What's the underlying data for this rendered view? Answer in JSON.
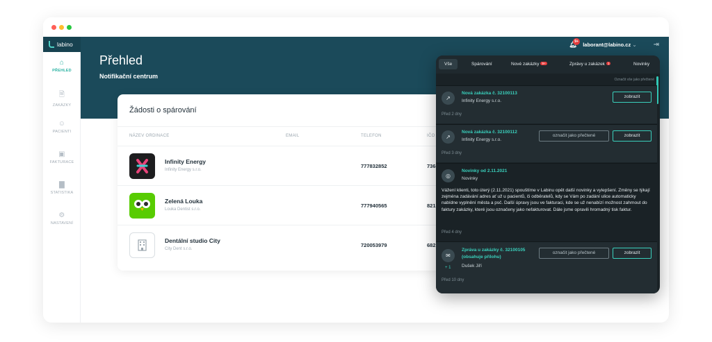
{
  "app": {
    "logo": "labino"
  },
  "topbar": {
    "user": "laborant@labino.cz",
    "notif_count": "9+"
  },
  "hero": {
    "title": "Přehled",
    "subtitle": "Notifikační centrum"
  },
  "sidebar": {
    "items": [
      {
        "label": "PŘEHLED",
        "icon": "home-icon",
        "active": true
      },
      {
        "label": "ZAKÁZKY",
        "icon": "document-icon",
        "active": false
      },
      {
        "label": "PACIENTI",
        "icon": "user-icon",
        "active": false
      },
      {
        "label": "FAKTURACE",
        "icon": "money-icon",
        "active": false
      },
      {
        "label": "STATISTIKA",
        "icon": "chart-icon",
        "active": false
      },
      {
        "label": "NASTAVENÍ",
        "icon": "gear-icon",
        "active": false
      }
    ]
  },
  "card": {
    "title": "Žádosti o spárování",
    "columns": [
      "NÁZEV ORDINACE",
      "EMAIL",
      "TELEFON",
      "IČO"
    ],
    "rows": [
      {
        "name": "Infinity Energy",
        "company": "Infinity Energy s.r.o.",
        "phone": "777832852",
        "ico": "736"
      },
      {
        "name": "Zelená Louka",
        "company": "Louka Dentist s.r.o.",
        "phone": "777940565",
        "ico": "821"
      },
      {
        "name": "Dentální studio City",
        "company": "City Dent s.r.o.",
        "phone": "720053979",
        "ico": "682"
      }
    ]
  },
  "panel": {
    "tabs": [
      {
        "label": "Vše"
      },
      {
        "label": "Spárování"
      },
      {
        "label": "Nové zakázky",
        "badge": "9+"
      },
      {
        "label": "Zprávy u zakázek",
        "badge": "1"
      },
      {
        "label": "Novinky"
      }
    ],
    "mark_all": "Označit vše jako přečtené",
    "mark_read": "označit jako přečtené",
    "show": "zobrazit",
    "items": [
      {
        "title": "Nová zakázka č. 32100113",
        "sub": "Infinity Energy s.r.o.",
        "date": "Před 2 dny"
      },
      {
        "title": "Nová zakázka č. 32100112",
        "sub": "Infinity Energy s.r.o.",
        "date": "Před 3 dny"
      },
      {
        "title": "Novinky od 2.11.2021",
        "sub": "Novinky",
        "body": "Vážení klienti, toto úterý (2.11.2021) spouštíme v Labinu opět další novinky a vylepšení. Změny se týkají zejména zadávání adres ať už u pacientů, či odběratelů, kdy se Vám po zadání ulice automaticky nabídne vyplnění města a psč. Další úpravy jsou ve fakturaci, kde se už nenabízí možnost zahrnout do faktury zakázky, které jsou označeny jako nefakturovat. Dále jsme opravili hromadný tisk faktur.",
        "date": "Před 4 dny"
      },
      {
        "title": "Zpráva u zakázky č. 32100105 (obsahuje přílohu)",
        "sub": "Dušek Jiří",
        "extra": "+ 1",
        "date": "Před 10 dny"
      }
    ]
  }
}
